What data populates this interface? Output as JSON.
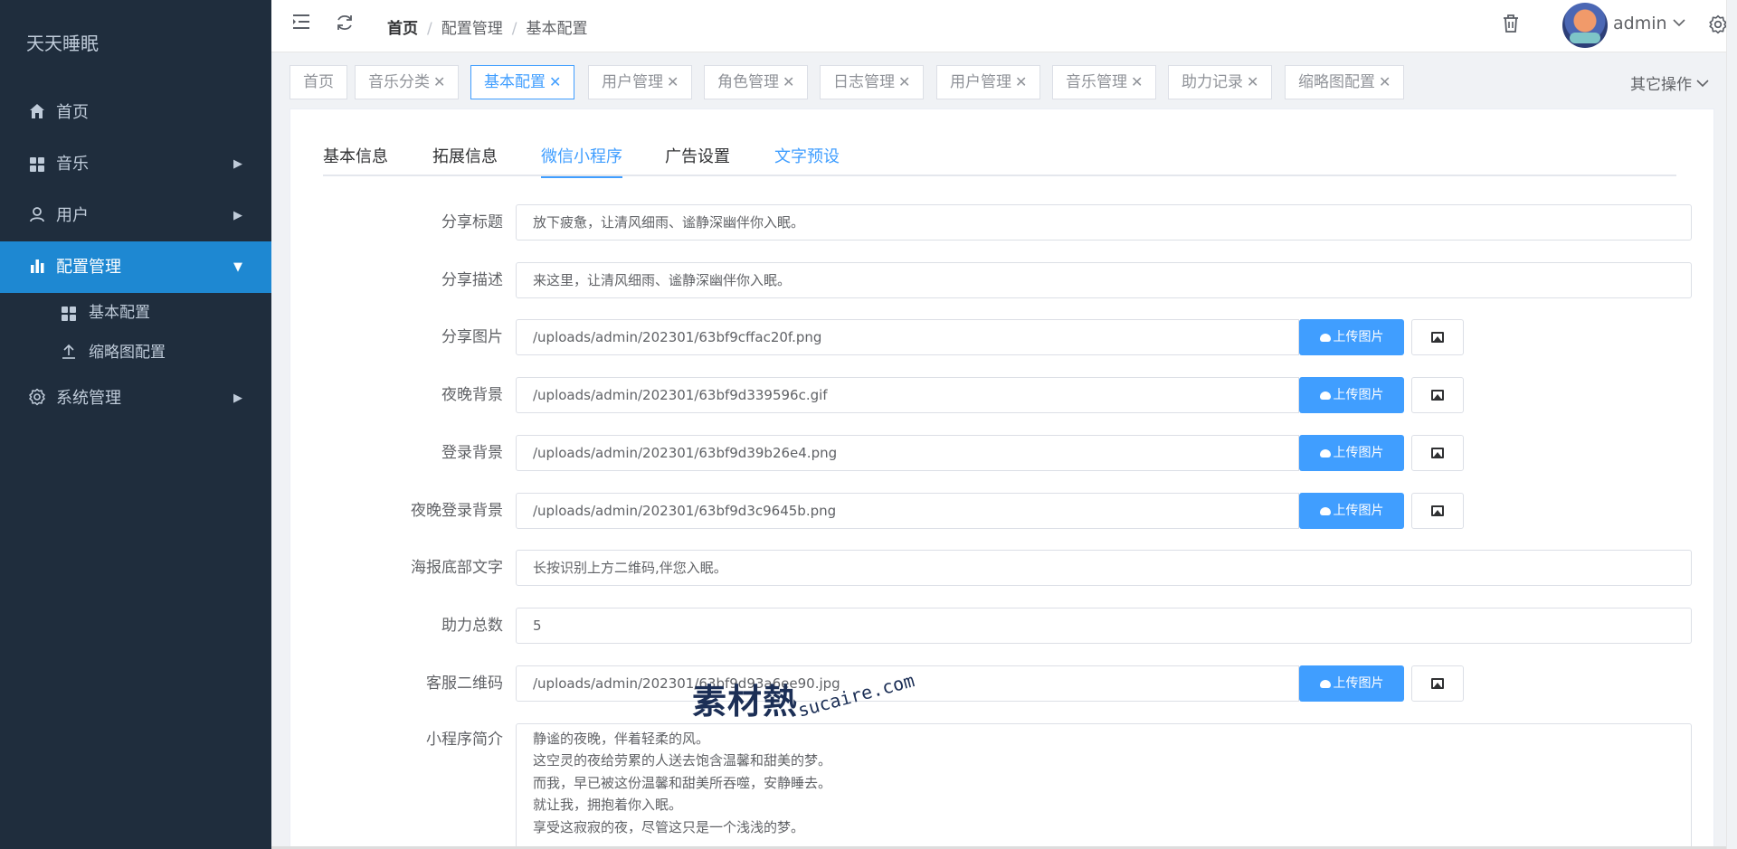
{
  "sidebar": {
    "brand": "天天睡眠",
    "items": [
      {
        "label": "首页",
        "icon": "home-icon"
      },
      {
        "label": "音乐",
        "icon": "grid-icon",
        "arrow": "▶"
      },
      {
        "label": "用户",
        "icon": "user-icon",
        "arrow": "▶"
      },
      {
        "label": "配置管理",
        "icon": "bar-chart-icon",
        "arrow": "▼"
      },
      {
        "label": "系统管理",
        "icon": "gear-icon",
        "arrow": "▶"
      }
    ],
    "sub_items": [
      {
        "label": "基本配置",
        "icon": "grid-icon"
      },
      {
        "label": "缩略图配置",
        "icon": "upload-icon"
      }
    ]
  },
  "header": {
    "breadcrumb": [
      "首页",
      "配置管理",
      "基本配置"
    ],
    "username": "admin"
  },
  "tags": [
    {
      "label": "首页",
      "closable": false
    },
    {
      "label": "音乐分类",
      "closable": true
    },
    {
      "label": "基本配置",
      "closable": true,
      "active": true
    },
    {
      "label": "用户管理",
      "closable": true
    },
    {
      "label": "角色管理",
      "closable": true
    },
    {
      "label": "日志管理",
      "closable": true
    },
    {
      "label": "用户管理",
      "closable": true
    },
    {
      "label": "音乐管理",
      "closable": true
    },
    {
      "label": "助力记录",
      "closable": true
    },
    {
      "label": "缩略图配置",
      "closable": true
    }
  ],
  "tag_close": "✕",
  "other_ops": "其它操作",
  "content_tabs": [
    "基本信息",
    "拓展信息",
    "微信小程序",
    "广告设置",
    "文字预设"
  ],
  "form": {
    "share_title": {
      "label": "分享标题",
      "value": "放下疲惫，让清风细雨、谧静深幽伴你入眠。"
    },
    "share_desc": {
      "label": "分享描述",
      "value": "来这里，让清风细雨、谧静深幽伴你入眠。"
    },
    "share_image": {
      "label": "分享图片",
      "value": "/uploads/admin/202301/63bf9cffac20f.png"
    },
    "night_bg": {
      "label": "夜晚背景",
      "value": "/uploads/admin/202301/63bf9d339596c.gif"
    },
    "login_bg": {
      "label": "登录背景",
      "value": "/uploads/admin/202301/63bf9d39b26e4.png"
    },
    "night_login_bg": {
      "label": "夜晚登录背景",
      "value": "/uploads/admin/202301/63bf9d3c9645b.png"
    },
    "poster_text": {
      "label": "海报底部文字",
      "value": "长按识别上方二维码,伴您入眠。"
    },
    "assist_total": {
      "label": "助力总数",
      "value": "5"
    },
    "service_qr": {
      "label": "客服二维码",
      "value": "/uploads/admin/202301/63bf9d93a6ee90.jpg"
    },
    "intro": {
      "label": "小程序简介",
      "lines": [
        "静谧的夜晚，伴着轻柔的风。",
        "这空灵的夜给劳累的人送去饱含温馨和甜美的梦。",
        "而我，早已被这份温馨和甜美所吞噬，安静睡去。",
        "就让我，拥抱着你入眠。",
        "享受这寂寂的夜，尽管这只是一个浅浅的梦。"
      ]
    },
    "upload_label": "上传图片"
  },
  "watermark": {
    "main": "素材熱",
    "sub": "sucaire.com"
  },
  "colors": {
    "sidebar_bg": "#1f2d3d",
    "active": "#1e88d2",
    "primary": "#409eff"
  }
}
